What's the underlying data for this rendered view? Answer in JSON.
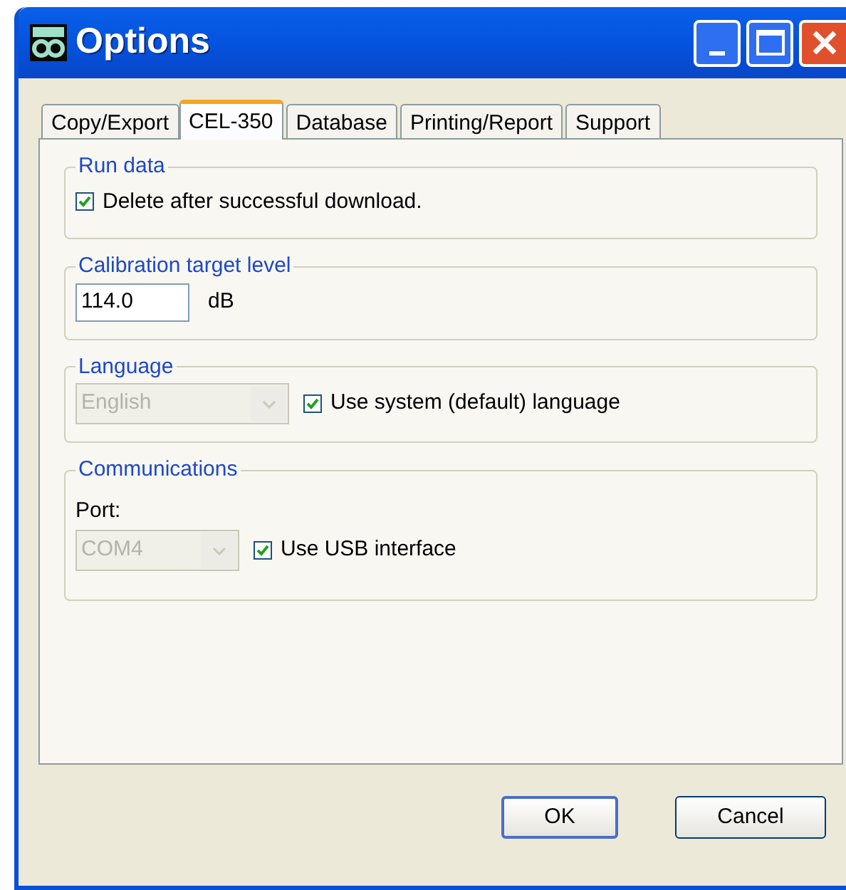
{
  "window": {
    "title": "Options"
  },
  "tabs": [
    {
      "label": "Copy/Export",
      "selected": false
    },
    {
      "label": "CEL-350",
      "selected": true
    },
    {
      "label": "Database",
      "selected": false
    },
    {
      "label": "Printing/Report",
      "selected": false
    },
    {
      "label": "Support",
      "selected": false
    }
  ],
  "groups": [
    {
      "kind": "checkbox",
      "title": "Run data",
      "checkbox": {
        "label": "Delete after successful download.",
        "checked": true
      }
    },
    {
      "kind": "field",
      "title": "Calibration target level",
      "value": "114.0",
      "unit": "dB"
    },
    {
      "kind": "dropdown",
      "title": "Language",
      "dropdown": {
        "value": "English",
        "disabled": true
      },
      "checkbox": {
        "label": "Use system (default) language",
        "checked": true
      }
    },
    {
      "kind": "port",
      "title": "Communications",
      "label": "Port:",
      "dropdown": {
        "value": "COM4",
        "disabled": true
      },
      "checkbox": {
        "label": "Use USB interface",
        "checked": true
      }
    }
  ],
  "buttons": [
    {
      "label": "OK",
      "default": true
    },
    {
      "label": "Cancel",
      "default": false
    }
  ]
}
